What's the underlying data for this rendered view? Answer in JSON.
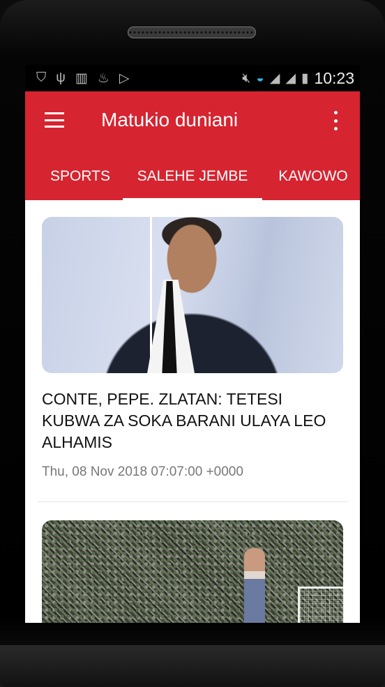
{
  "statusbar": {
    "time": "10:23",
    "left_icons": [
      "shield-icon",
      "usb-icon",
      "barcode-icon",
      "flame-icon",
      "play-store-icon"
    ],
    "right_icons": [
      "mute-icon",
      "wifi-icon",
      "signal-off-icon",
      "signal-icon",
      "battery-charging-icon"
    ]
  },
  "appbar": {
    "title": "Matukio duniani",
    "color": "#d62430"
  },
  "tabs": [
    {
      "label": "SPORTS"
    },
    {
      "label": "SALEHE JEMBE",
      "active": true
    },
    {
      "label": "KAWOWO"
    }
  ],
  "articles": [
    {
      "headline": "CONTE, PEPE. ZLATAN: TETESI KUBWA ZA SOKA BARANI ULAYA LEO ALHAMIS",
      "date": "Thu, 08 Nov 2018 07:07:00 +0000"
    },
    {
      "headline": "",
      "date": ""
    }
  ]
}
